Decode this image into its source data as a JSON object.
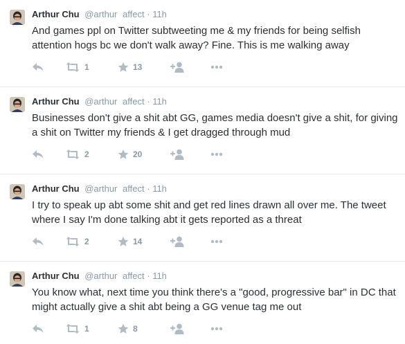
{
  "colors": {
    "text": "#292f33",
    "meta": "#8899a6",
    "icon": "#b1bbc3",
    "divider": "#e1e8ed"
  },
  "tweets": [
    {
      "name": "Arthur Chu",
      "handle": "@arthur",
      "list": "affect",
      "dot": "·",
      "time": "11h",
      "text": "And games ppl on Twitter subtweeting me & my friends for being selfish attention hogs bc we don't walk away? Fine. This is me walking away",
      "retweets": "1",
      "favorites": "13"
    },
    {
      "name": "Arthur Chu",
      "handle": "@arthur",
      "list": "affect",
      "dot": "·",
      "time": "11h",
      "text": "Businesses don't give a shit abt GG, games media doesn't give a shit, for giving a shit on Twitter my friends & I get dragged through mud",
      "retweets": "2",
      "favorites": "20"
    },
    {
      "name": "Arthur Chu",
      "handle": "@arthur",
      "list": "affect",
      "dot": "·",
      "time": "11h",
      "text": "I try to speak up abt some shit and get red lines drawn all over me. The tweet where I say I'm done talking abt it gets reported as a threat",
      "retweets": "2",
      "favorites": "14"
    },
    {
      "name": "Arthur Chu",
      "handle": "@arthur",
      "list": "affect",
      "dot": "·",
      "time": "11h",
      "text": "You know what, next time you think there's a \"good, progressive bar\" in DC that might actually give a shit abt being a GG venue tag me out",
      "retweets": "1",
      "favorites": "8"
    }
  ],
  "icons": [
    "reply-icon",
    "retweet-icon",
    "star-icon",
    "follow-icon",
    "more-icon"
  ]
}
